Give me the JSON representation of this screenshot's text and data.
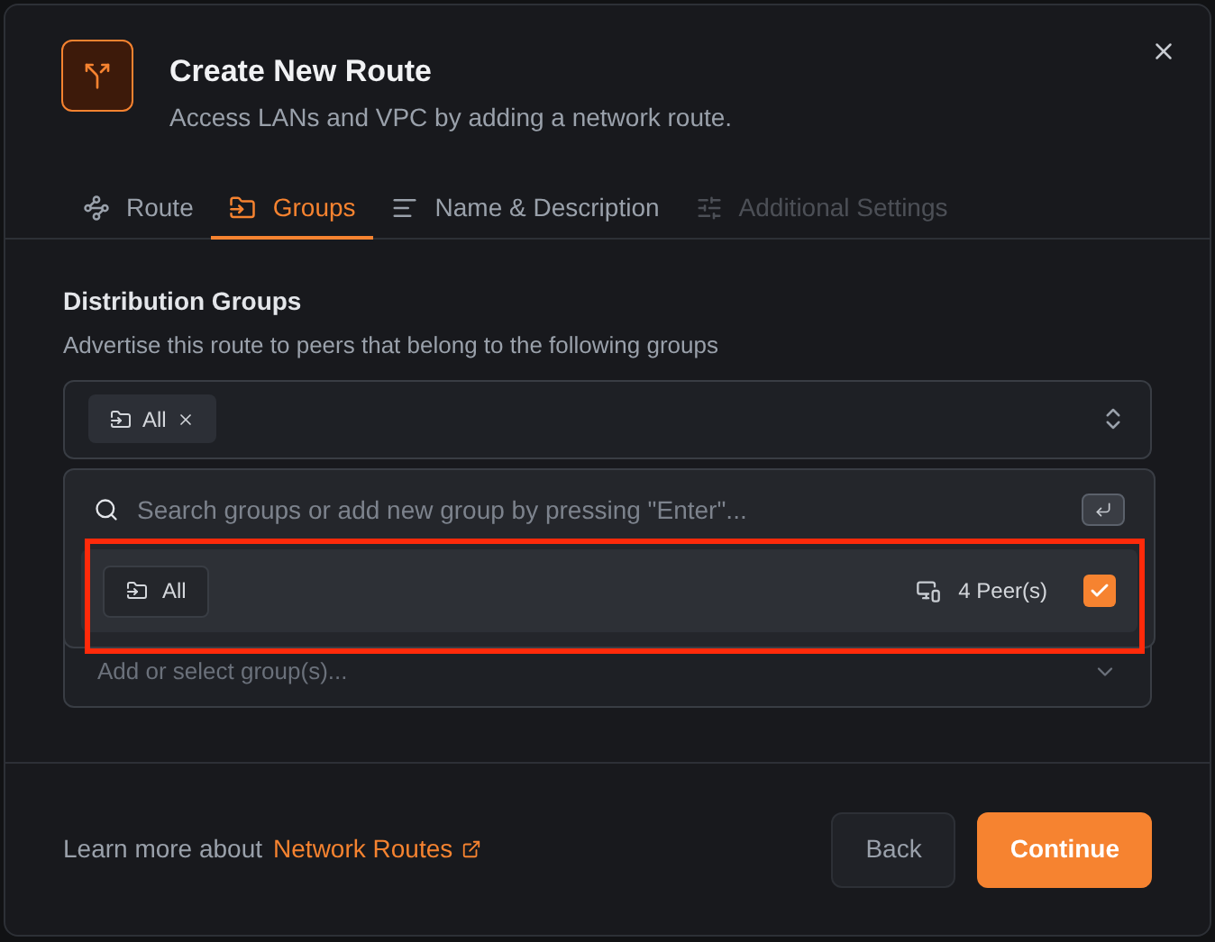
{
  "dialog": {
    "title": "Create New Route",
    "subtitle": "Access LANs and VPC by adding a network route."
  },
  "tabs": [
    {
      "label": "Route",
      "kind": "route",
      "selected": false,
      "disabled": false
    },
    {
      "label": "Groups",
      "kind": "groups",
      "selected": true,
      "disabled": false
    },
    {
      "label": "Name & Description",
      "kind": "text",
      "selected": false,
      "disabled": false
    },
    {
      "label": "Additional Settings",
      "kind": "settings",
      "selected": false,
      "disabled": true
    }
  ],
  "section": {
    "title": "Distribution Groups",
    "description": "Advertise this route to peers that belong to the following groups"
  },
  "selected_groups": [
    {
      "label": "All"
    }
  ],
  "second_field": {
    "placeholder": "Add or select group(s)..."
  },
  "dropdown": {
    "search_placeholder": "Search groups or add new group by pressing \"Enter\"...",
    "highlighted": true,
    "options": [
      {
        "label": "All",
        "peers": "4 Peer(s)",
        "checked": true
      }
    ]
  },
  "footer": {
    "text": "Learn more about",
    "link": "Network Routes",
    "buttons": [
      {
        "label": "Back",
        "kind": "secondary"
      },
      {
        "label": "Continue",
        "kind": "primary"
      }
    ]
  }
}
